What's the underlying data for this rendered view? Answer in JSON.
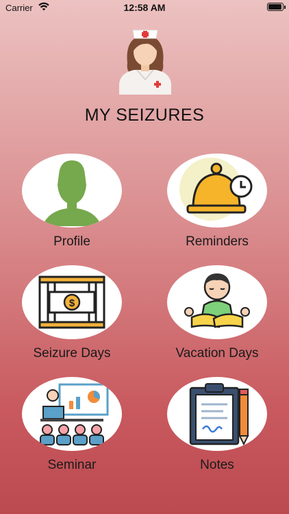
{
  "status_bar": {
    "carrier": "Carrier",
    "time": "12:58 AM",
    "battery_level": 0.95
  },
  "app": {
    "title": "MY SEIZURES"
  },
  "tiles": [
    {
      "label": "Profile",
      "icon": "person-silhouette-icon"
    },
    {
      "label": "Reminders",
      "icon": "bell-clock-icon"
    },
    {
      "label": "Seizure Days",
      "icon": "money-cage-icon"
    },
    {
      "label": "Vacation Days",
      "icon": "meditating-girl-icon"
    },
    {
      "label": "Seminar",
      "icon": "seminar-audience-icon"
    },
    {
      "label": "Notes",
      "icon": "clipboard-pencil-icon"
    }
  ],
  "colors": {
    "background_top": "#ecc2c1",
    "background_bottom": "#bb4a50",
    "profile_green": "#76a84d",
    "bell_yellow": "#f5b42a"
  }
}
